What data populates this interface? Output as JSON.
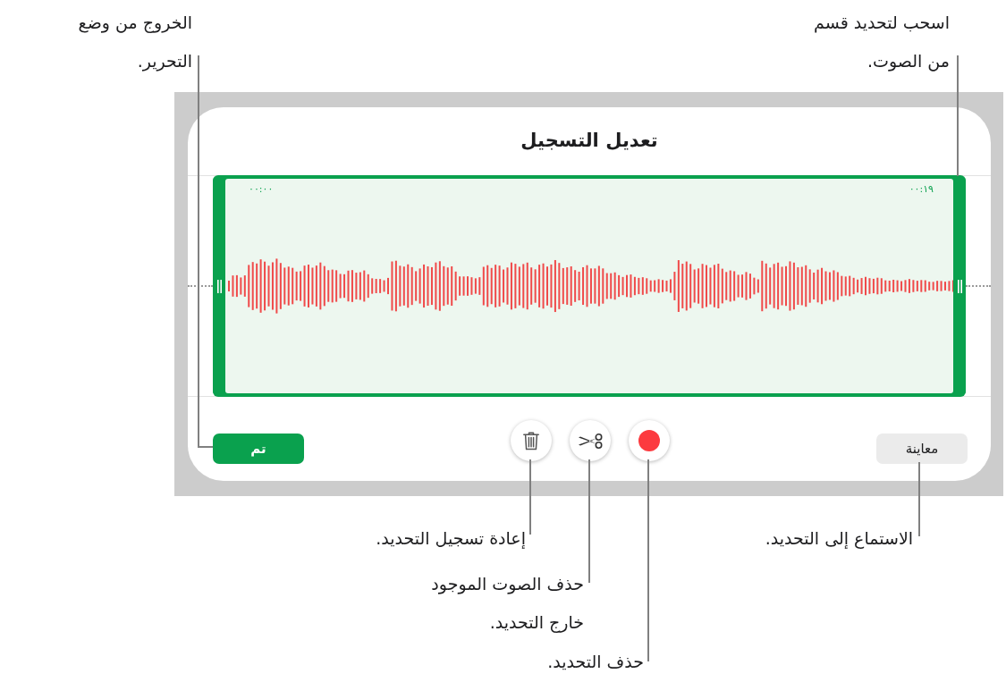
{
  "editor": {
    "title": "تعديل التسجيل",
    "selection": {
      "start_time": "٠٠:٠٠",
      "end_time": "٠٠:١٩",
      "callout": [
        "اسحب لتحديد قسم",
        "من الصوت."
      ]
    },
    "done_button": {
      "label": "تم",
      "callout": [
        "الخروج من وضع",
        "التحرير."
      ]
    },
    "delete_button": {
      "callout": [
        "إعادة تسجيل التحديد."
      ]
    },
    "trim_button": {
      "callout": [
        "حذف الصوت الموجود",
        "خارج التحديد."
      ]
    },
    "record_button": {
      "callout": [
        "حذف التحديد."
      ]
    },
    "preview_button": {
      "label": "معاينة",
      "callout": [
        "الاستماع إلى التحديد."
      ]
    }
  }
}
